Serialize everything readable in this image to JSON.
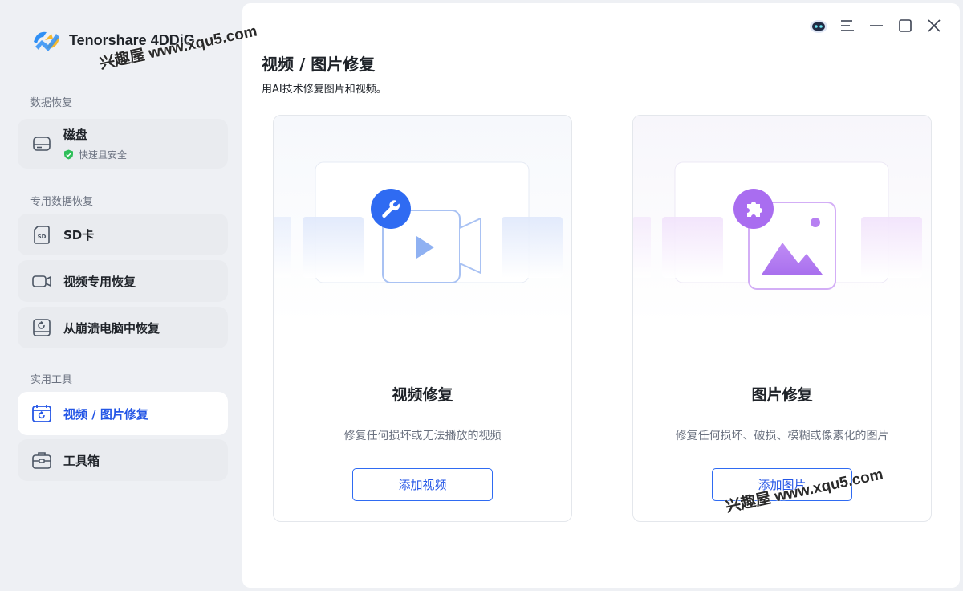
{
  "app": {
    "name": "Tenorshare 4DDiG"
  },
  "sidebar": {
    "sections": [
      {
        "title": "数据恢复"
      },
      {
        "title": "专用数据恢复"
      },
      {
        "title": "实用工具"
      }
    ],
    "items": [
      {
        "label": "磁盘",
        "sub": "快速且安全",
        "icon": "hard-drive-icon"
      },
      {
        "label": "SD卡",
        "icon": "sd-card-icon"
      },
      {
        "label": "视频专用恢复",
        "icon": "video-camera-icon"
      },
      {
        "label": "从崩溃电脑中恢复",
        "icon": "crashed-computer-icon"
      },
      {
        "label": "视频 / 图片修复",
        "icon": "repair-calendar-icon",
        "active": true
      },
      {
        "label": "工具箱",
        "icon": "toolbox-icon"
      }
    ]
  },
  "main": {
    "title": "视频 / 图片修复",
    "subtitle": "用AI技术修复图片和视频。",
    "cards": [
      {
        "title": "视频修复",
        "desc": "修复任何损坏或无法播放的视频",
        "button": "添加视频"
      },
      {
        "title": "图片修复",
        "desc": "修复任何损坏、破损、模糊或像素化的图片",
        "button": "添加图片"
      }
    ]
  },
  "watermarks": [
    "兴趣屋 www.xqu5.com",
    "兴趣屋 www.xqu5.com"
  ],
  "colors": {
    "accent": "#2456e6",
    "video": "#2f6bf2",
    "image": "#a96df0"
  }
}
